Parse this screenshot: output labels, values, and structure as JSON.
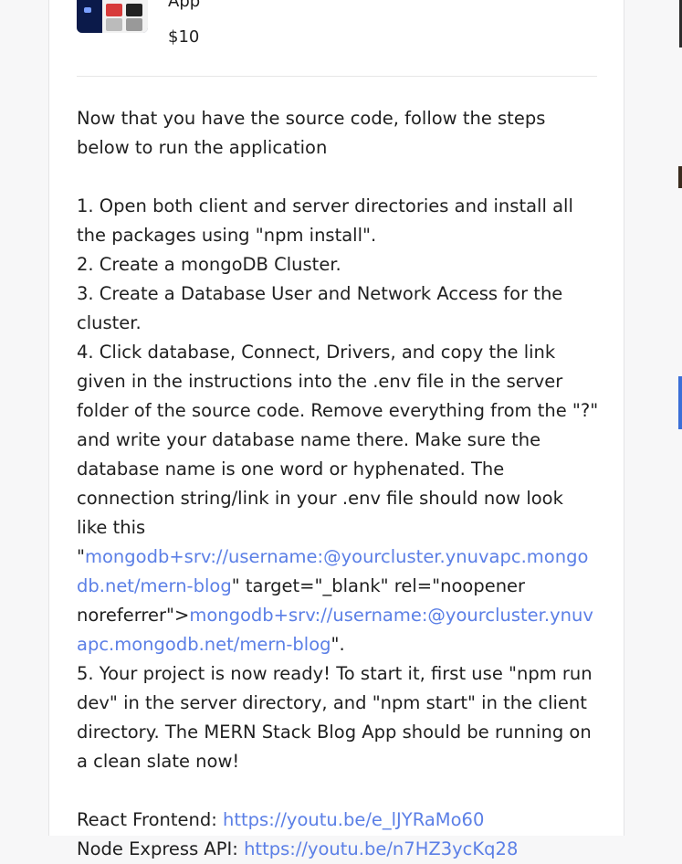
{
  "product": {
    "title": "App",
    "price": "$10"
  },
  "instructions": {
    "intro": "Now that you have the source code, follow the steps below to run the application",
    "step1": "1. Open both client and server directories and install all the packages using \"npm install\".",
    "step2": "2. Create a mongoDB Cluster.",
    "step3": "3. Create a Database User and Network Access for the cluster.",
    "step4_text": "4. Click database, Connect, Drivers, and copy the link given in the instructions into the .env file in the server folder of the source code. Remove everything from the \"?\" and write your database name there. Make sure the database name is one word or hyphenated. The connection string/link in your .env file should now look like this",
    "step4_quote_open": "\"",
    "step4_link1": "mongodb+srv://username:@yourcluster.ynuvapc.mongodb.net/mern-blog",
    "step4_attrs": "\" target=\"_blank\" rel=\"noopener noreferrer\">",
    "step4_link2": "mongodb+srv://username:@yourcluster.ynuvapc.mongodb.net/mern-blog",
    "step4_end": "\".",
    "step5": "5. Your project is now ready! To start it, first use \"npm run dev\" in the server directory, and \"npm start\" in the client directory. The MERN Stack Blog App should be running on a clean slate now!"
  },
  "links": {
    "frontend_label": "React Frontend: ",
    "frontend_url": "https://youtu.be/e_lJYRaMo60",
    "api_label": "Node Express API: ",
    "api_url": "https://youtu.be/n7HZ3ycKq28"
  },
  "colors": {
    "link": "#5b7fe6",
    "text": "#1f1f1f"
  }
}
